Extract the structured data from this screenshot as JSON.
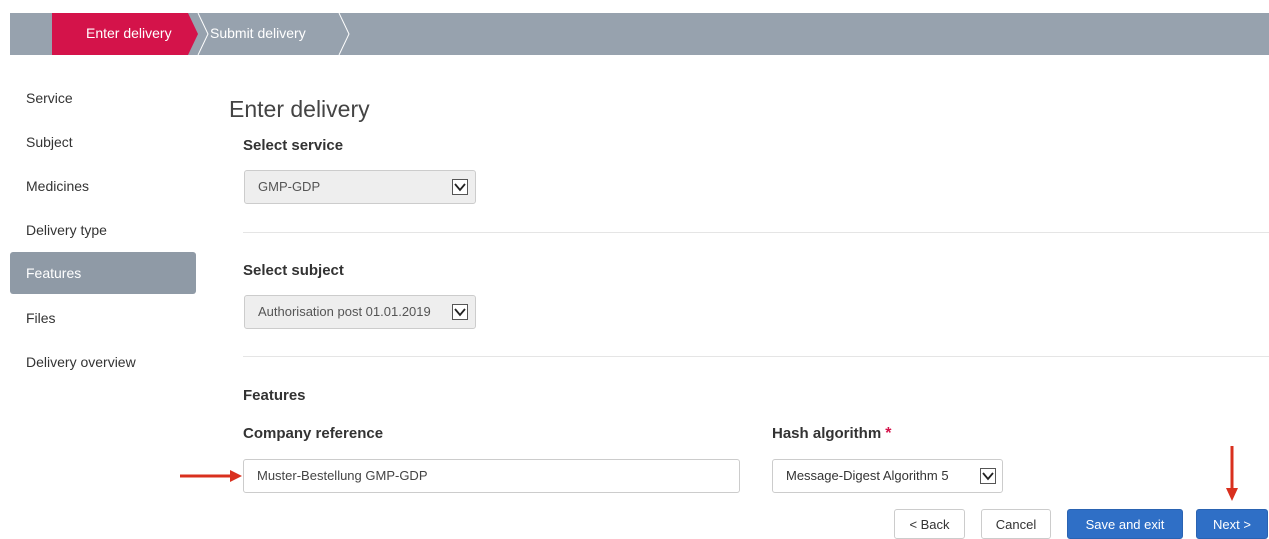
{
  "steps": {
    "active_label": "Enter delivery",
    "next_label": "Submit delivery"
  },
  "sidebar": {
    "items": [
      {
        "label": "Service"
      },
      {
        "label": "Subject"
      },
      {
        "label": "Medicines"
      },
      {
        "label": "Delivery type"
      },
      {
        "label": "Features"
      },
      {
        "label": "Files"
      },
      {
        "label": "Delivery overview"
      }
    ],
    "active": "Features"
  },
  "main": {
    "title": "Enter delivery",
    "service": {
      "label": "Select service",
      "value": "GMP-GDP"
    },
    "subject": {
      "label": "Select subject",
      "value": "Authorisation post 01.01.2019"
    },
    "features": {
      "heading": "Features",
      "company_reference": {
        "label": "Company reference",
        "value": "Muster-Bestellung GMP-GDP"
      },
      "hash_algorithm": {
        "label": "Hash algorithm",
        "required_mark": "*",
        "value": "Message-Digest Algorithm 5"
      }
    }
  },
  "buttons": {
    "back": "< Back",
    "cancel": "Cancel",
    "save_exit": "Save and exit",
    "next": "Next >"
  },
  "colors": {
    "accent": "#d4134a",
    "primary": "#2f6fc6",
    "bar": "#97a2ae",
    "annotation_arrow": "#d9301e"
  }
}
